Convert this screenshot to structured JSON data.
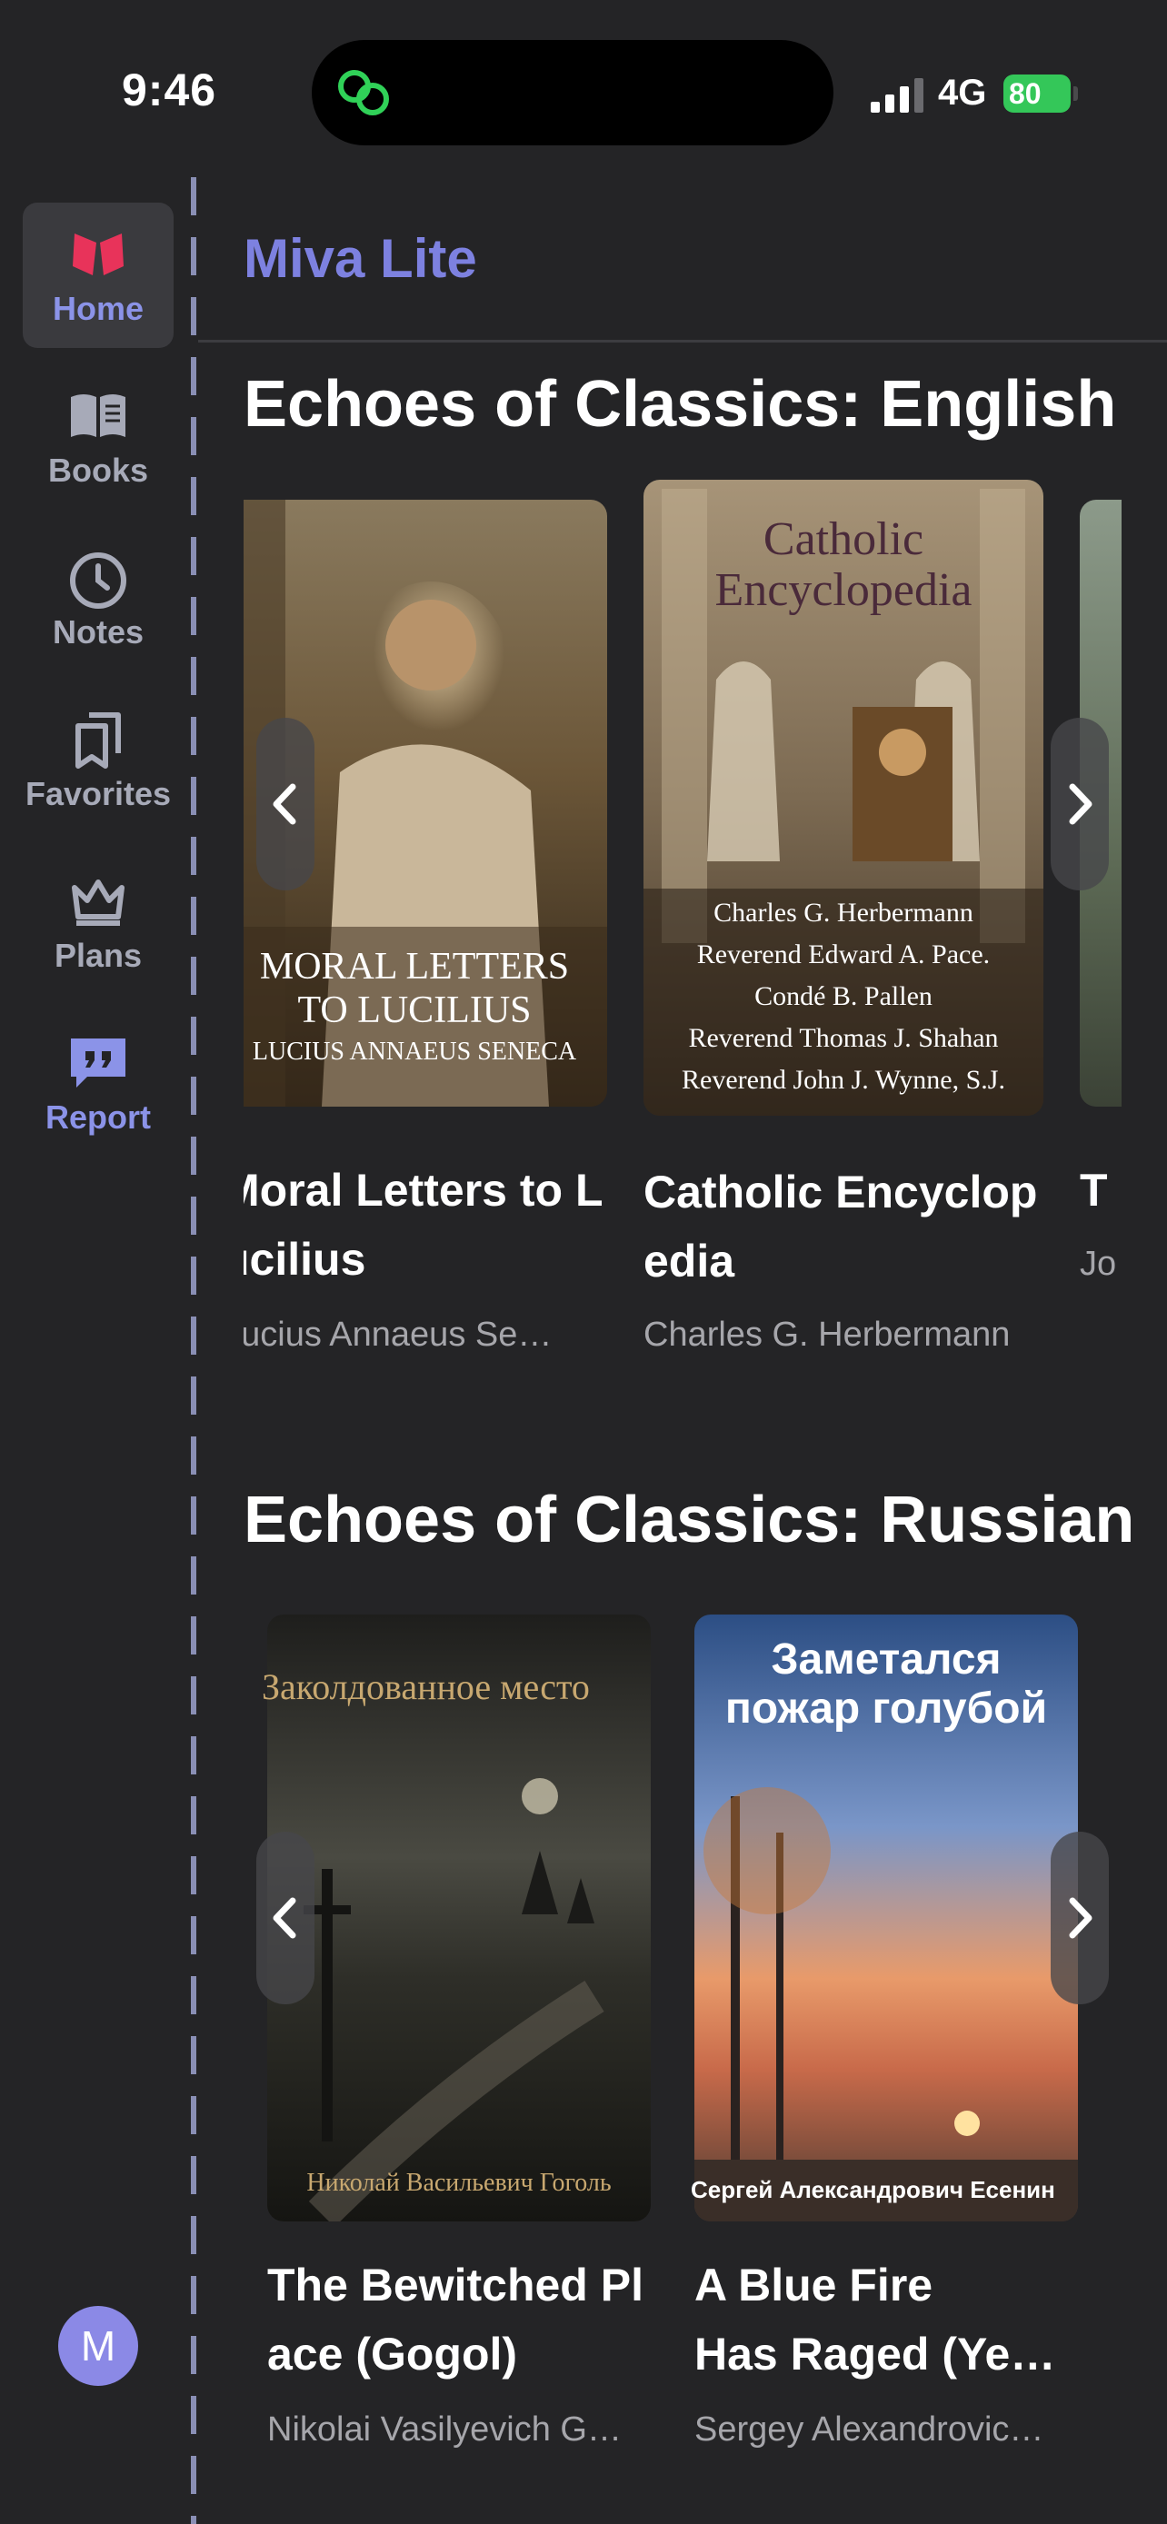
{
  "status_bar": {
    "time": "9:46",
    "network": "4G",
    "battery": "80"
  },
  "app": {
    "title": "Miva Lite"
  },
  "sidebar": {
    "items": [
      {
        "label": "Home",
        "icon": "book-logo-icon",
        "active": true
      },
      {
        "label": "Books",
        "icon": "open-book-icon"
      },
      {
        "label": "Notes",
        "icon": "clock-icon"
      },
      {
        "label": "Favorites",
        "icon": "bookmarks-icon"
      },
      {
        "label": "Plans",
        "icon": "crown-icon"
      },
      {
        "label": "Report",
        "icon": "quote-bubble-icon"
      }
    ],
    "avatar_initial": "M"
  },
  "sections": [
    {
      "title": "Echoes of Classics: English",
      "books": [
        {
          "title": "Moral Letters to Lucilius",
          "author": "Lucius Annaeus Seneca",
          "cover_text": [
            "MORAL LETTERS",
            "TO LUCILIUS",
            "LUCIUS ANNAEUS SENECA"
          ]
        },
        {
          "title": "Catholic Encyclopedia",
          "author": "Charles G. Herbermann",
          "cover_text": [
            "Catholic",
            "Encyclopedia",
            "Charles G. Herbermann",
            "Reverend Edward A. Pace.",
            "Condé B. Pallen",
            "Reverend Thomas J. Shahan",
            "Reverend John J. Wynne, S.J."
          ]
        },
        {
          "title": "T",
          "author": "Jo"
        }
      ]
    },
    {
      "title": "Echoes of Classics: Russian",
      "books": [
        {
          "title": "The Bewitched Place (Gogol)",
          "author": "Nikolai Vasilyevich Gogol",
          "cover_text": [
            "Заколдованное место",
            "Николай Васильевич Гоголь"
          ]
        },
        {
          "title": "A Blue Fire Has Raged (Yesenin)",
          "author": "Sergey Alexandrovich Yesenin",
          "cover_text": [
            "Заметался",
            "пожар голубой",
            "Сергей Александрович Есенин"
          ]
        }
      ]
    }
  ],
  "colors": {
    "accent": "#7d81e0",
    "logo": "#e8335a",
    "background": "#242426"
  }
}
